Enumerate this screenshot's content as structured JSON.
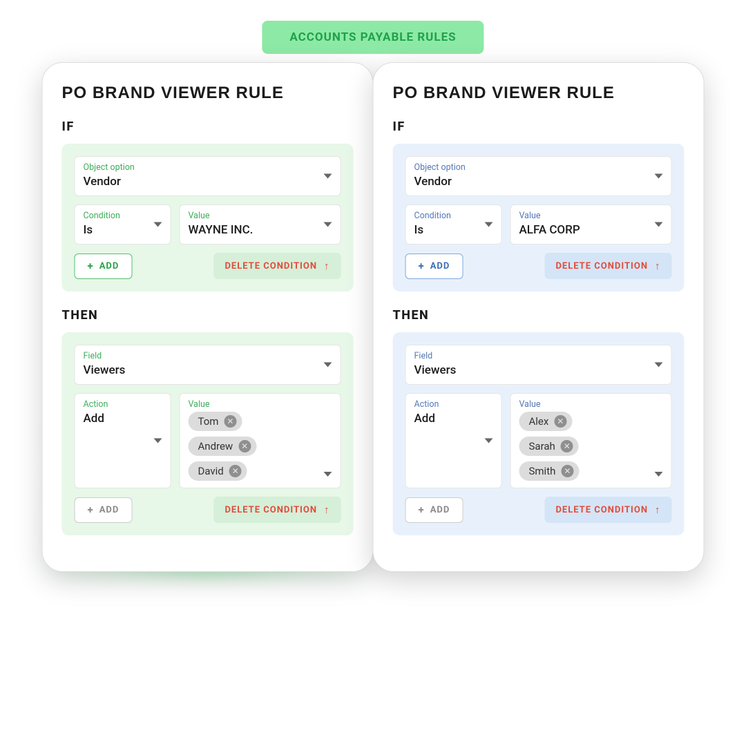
{
  "header_label": "ACCOUNTS PAYABLE RULES",
  "labels": {
    "if": "IF",
    "then": "THEN",
    "add": "ADD",
    "delete": "DELETE CONDITION",
    "object_option": "Object option",
    "condition": "Condition",
    "value": "Value",
    "field": "Field",
    "action": "Action"
  },
  "rules": [
    {
      "title": "PO BRAND VIEWER RULE",
      "theme": "green",
      "if": {
        "object_option": "Vendor",
        "condition": "Is",
        "value": "WAYNE INC."
      },
      "then": {
        "field": "Viewers",
        "action": "Add",
        "chips": [
          "Tom",
          "Andrew",
          "David"
        ]
      }
    },
    {
      "title": "PO BRAND VIEWER RULE",
      "theme": "blue",
      "if": {
        "object_option": "Vendor",
        "condition": "Is",
        "value": "ALFA CORP"
      },
      "then": {
        "field": "Viewers",
        "action": "Add",
        "chips": [
          "Alex",
          "Sarah",
          "Smith"
        ]
      }
    }
  ]
}
